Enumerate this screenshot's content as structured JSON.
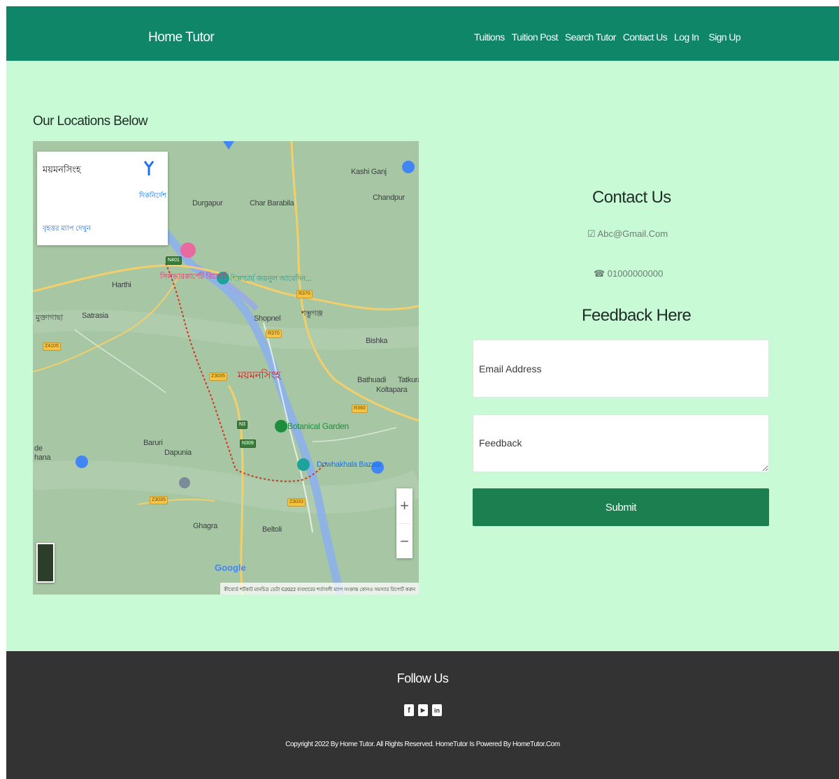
{
  "navbar": {
    "brand": "Home Tutor",
    "links": [
      "Tuitions",
      "Tuition Post",
      "Search Tutor",
      "Contact Us",
      "Log In",
      "Sign Up"
    ]
  },
  "locations": {
    "title": "Our Locations Below"
  },
  "map": {
    "info_place": "ময়মনসিংহ",
    "info_directions": "দিকনির্দেশ",
    "info_bigger_map": "বৃহত্তর ম্যাপ দেখুন",
    "labels": {
      "durgapur": "Durgapur",
      "char_barabila": "Char Barabila",
      "kashi_ganj": "Kashi Ganj",
      "chandpur": "Chandpur",
      "harthi": "Harthi",
      "satrasia": "Satrasia",
      "shopnel": "Shopnel",
      "bishka": "Bishka",
      "bathuadi": "Bathuadi",
      "tatkura": "Tatkura",
      "koltapara": "Koltapara",
      "baruri": "Baruri",
      "dapunia": "Dapunia",
      "ghagra": "Ghagra",
      "beltoli": "Beltoli",
      "city": "ময়মনসিংহ",
      "botanical_garden": "Botanical Garden",
      "dowhakhala_bazaar": "Dowhakhala Bazaar",
      "poi_pink": "সিলভারকার্পেট রিসোর্ট",
      "poi_teal": "শিল্পাচার্য জয়নুল আবেদিন...",
      "shombhuganj": "শম্ভুগঞ্জ",
      "muktagachha": "মুক্তাগাছা",
      "de": "de",
      "hana": "hana"
    },
    "roads": {
      "n401": "N401",
      "r370a": "R370",
      "r370b": "R370",
      "z4105": "Z4105",
      "z3035a": "Z3035",
      "n3": "N3",
      "n309": "N309",
      "z3035b": "Z3035",
      "z3033": "Z3033",
      "r360": "R360"
    },
    "zoom_in": "+",
    "zoom_out": "−",
    "google": "Google",
    "attribution": "কীবোর্ড শর্টকাট   মানচিত্র ডেটা ©2022   ব্যবহারের শর্তাবলী   ম্যাপ সংক্রান্ত কোনও সমস্যার রিপোর্ট করুন"
  },
  "contact": {
    "title": "Contact Us",
    "email": "☑ Abc@Gmail.Com",
    "phone": "☎ 01000000000",
    "feedback_title": "Feedback Here",
    "email_placeholder": "Email Address",
    "feedback_placeholder": "Feedback",
    "submit_label": "Submit"
  },
  "footer": {
    "follow": "Follow Us",
    "icons": [
      "facebook-icon",
      "youtube-icon",
      "linkedin-icon"
    ],
    "icon_glyphs": [
      "f",
      "▶",
      "in"
    ],
    "copyright": "Copyright 2022 By Home Tutor. All Rights Reserved. HomeTutor Is Powered By HomeTutor.Com"
  },
  "colors": {
    "navbar": "#0e8667",
    "page_bg": "#c9fad6",
    "submit": "#1b7f4f",
    "footer": "#333333"
  }
}
